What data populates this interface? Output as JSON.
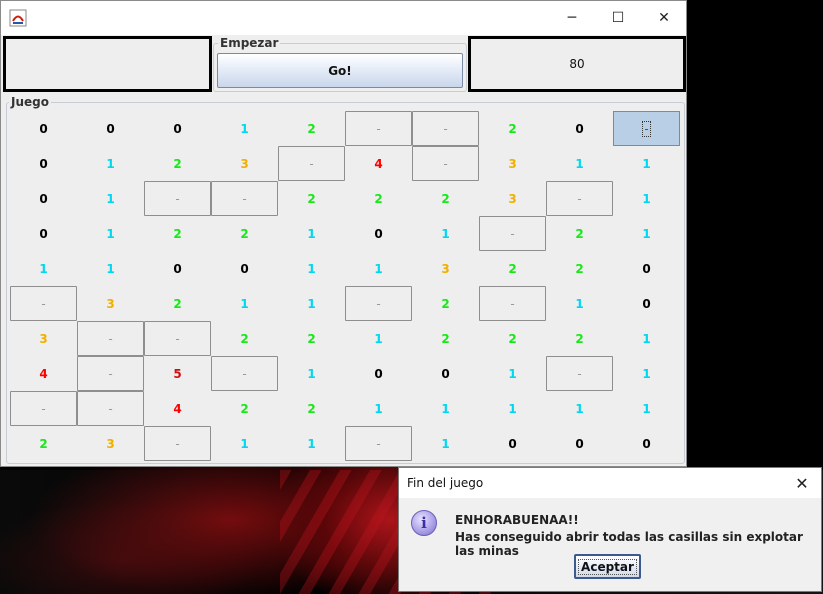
{
  "window": {
    "controls": {
      "minimize": "─",
      "maximize": "☐",
      "close": "✕"
    }
  },
  "counter": "80",
  "empezar": {
    "label": "Empezar",
    "button": "Go!"
  },
  "juego": {
    "label": "Juego"
  },
  "board": [
    [
      "0",
      "0",
      "0",
      "1",
      "2",
      "-",
      "-",
      "2",
      "0",
      "-"
    ],
    [
      "0",
      "1",
      "2",
      "3",
      "-",
      "4",
      "-",
      "3",
      "1",
      "1"
    ],
    [
      "0",
      "1",
      "-",
      "-",
      "2",
      "2",
      "2",
      "3",
      "-",
      "1"
    ],
    [
      "0",
      "1",
      "2",
      "2",
      "1",
      "0",
      "1",
      "-",
      "2",
      "1"
    ],
    [
      "1",
      "1",
      "0",
      "0",
      "1",
      "1",
      "3",
      "2",
      "2",
      "0"
    ],
    [
      "-",
      "3",
      "2",
      "1",
      "1",
      "-",
      "2",
      "-",
      "1",
      "0"
    ],
    [
      "3",
      "-",
      "-",
      "2",
      "2",
      "1",
      "2",
      "2",
      "2",
      "1"
    ],
    [
      "4",
      "-",
      "5",
      "-",
      "1",
      "0",
      "0",
      "1",
      "-",
      "1"
    ],
    [
      "-",
      "-",
      "4",
      "2",
      "2",
      "1",
      "1",
      "1",
      "1",
      "1"
    ],
    [
      "2",
      "3",
      "-",
      "1",
      "1",
      "-",
      "1",
      "0",
      "0",
      "0"
    ]
  ],
  "selected_cell": {
    "row": 0,
    "col": 9
  },
  "number_colors": {
    "0": "#000000",
    "1": "#00d8f0",
    "2": "#18e818",
    "3": "#f0b000",
    "4": "#ff0000",
    "5": "#d01010"
  },
  "dialog": {
    "title": "Fin del juego",
    "close": "✕",
    "icon": "info-icon",
    "line1": "ENHORABUENAA!!",
    "line2": "Has conseguido abrir todas las casillas sin explotar las minas",
    "ok": "Aceptar"
  }
}
